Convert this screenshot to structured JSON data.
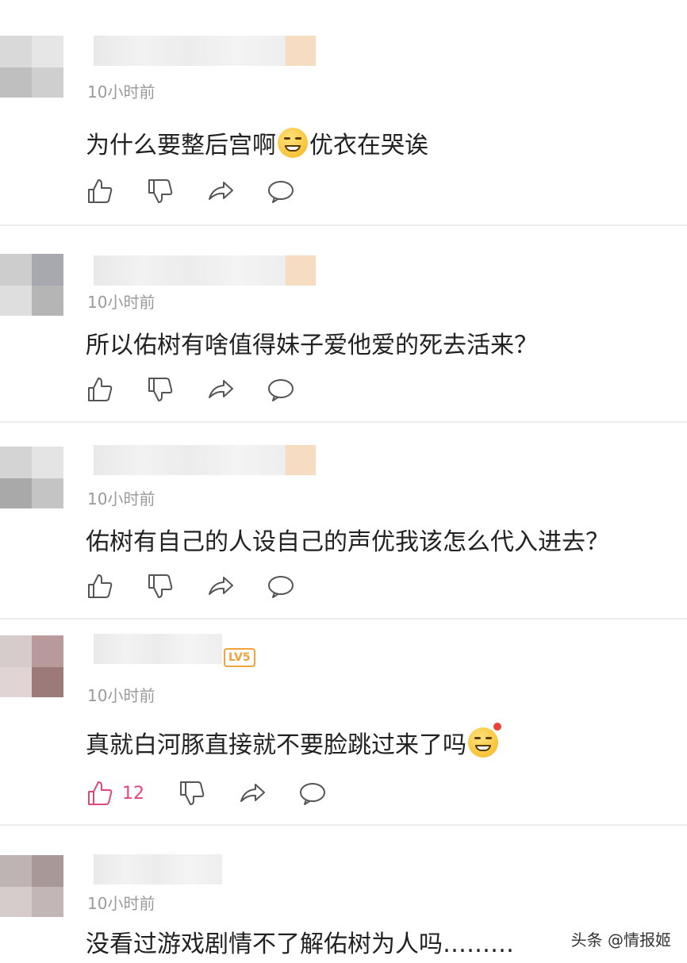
{
  "comments": [
    {
      "time": "10小时前",
      "text_before": "为什么要整后宫啊",
      "text_after": "优衣在哭诶",
      "emoji": "dizzy-face-emoji",
      "likes": ""
    },
    {
      "time": "10小时前",
      "text_before": "所以佑树有啥值得妹子爱他爱的死去活来？",
      "text_after": "",
      "emoji": "",
      "likes": ""
    },
    {
      "time": "10小时前",
      "text_before": "佑树有自己的人设自己的声优我该怎么代入进去？",
      "text_after": "",
      "emoji": "",
      "likes": ""
    },
    {
      "time": "10小时前",
      "text_before": "真就白河豚直接就不要脸跳过来了吗",
      "text_after": "",
      "emoji": "grinning-face-emoji",
      "likes": "12",
      "level_badge": "LV5"
    },
    {
      "time": "10小时前",
      "text_before": "没看过游戏剧情不了解佑树为人吗………",
      "text_after": "",
      "emoji": "",
      "likes": ""
    }
  ],
  "watermark": "头条 @情报姬",
  "colors": {
    "liked": "#e3477a",
    "icon": "#555555",
    "badge": "#f4a23c",
    "time": "#9a9a9a"
  },
  "icons": [
    "thumb-up-icon",
    "thumb-down-icon",
    "share-icon",
    "reply-icon"
  ]
}
